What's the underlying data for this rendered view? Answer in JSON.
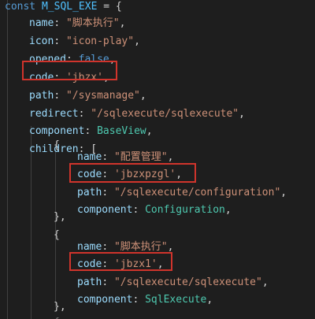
{
  "editor": {
    "decl_keyword": "const",
    "decl_name": "M_SQL_EXE",
    "decl_rest": " = {",
    "lines": [
      {
        "key": "name",
        "colon": ": ",
        "value": "\"脚本执行\"",
        "vtype": "str",
        "tail": ","
      },
      {
        "key": "icon",
        "colon": ": ",
        "value": "\"icon-play\"",
        "vtype": "str",
        "tail": ","
      },
      {
        "key": "opened",
        "colon": ": ",
        "value": "false",
        "vtype": "bool",
        "tail": ","
      },
      {
        "key": "code",
        "colon": ": ",
        "value": "'jbzx'",
        "vtype": "str",
        "tail": ","
      },
      {
        "key": "path",
        "colon": ": ",
        "value": "\"/sysmanage\"",
        "vtype": "str",
        "tail": ","
      },
      {
        "key": "redirect",
        "colon": ": ",
        "value": "\"/sqlexecute/sqlexecute\"",
        "vtype": "str",
        "tail": ","
      },
      {
        "key": "component",
        "colon": ": ",
        "value": "BaseView",
        "vtype": "ident",
        "tail": ","
      },
      {
        "key": "children",
        "colon": ": ",
        "value": "[",
        "vtype": "plain",
        "tail": ""
      }
    ],
    "child1": [
      {
        "key": "name",
        "colon": ": ",
        "value": "\"配置管理\"",
        "vtype": "str",
        "tail": ","
      },
      {
        "key": "code",
        "colon": ": ",
        "value": "'jbzxpzgl'",
        "vtype": "str",
        "tail": ","
      },
      {
        "key": "path",
        "colon": ": ",
        "value": "\"/sqlexecute/configuration\"",
        "vtype": "str",
        "tail": ","
      },
      {
        "key": "component",
        "colon": ": ",
        "value": "Configuration",
        "vtype": "ident",
        "tail": ","
      }
    ],
    "child2": [
      {
        "key": "name",
        "colon": ": ",
        "value": "\"脚本执行\"",
        "vtype": "str",
        "tail": ","
      },
      {
        "key": "code",
        "colon": ": ",
        "value": "'jbzx1'",
        "vtype": "str",
        "tail": ","
      },
      {
        "key": "path",
        "colon": ": ",
        "value": "\"/sqlexecute/sqlexecute\"",
        "vtype": "str",
        "tail": ","
      },
      {
        "key": "component",
        "colon": ": ",
        "value": "SqlExecute",
        "vtype": "ident",
        "tail": ","
      }
    ],
    "open_brace": "{",
    "close_brace": "},",
    "partial_brace": "{",
    "highlight_color": "#d0342c"
  }
}
